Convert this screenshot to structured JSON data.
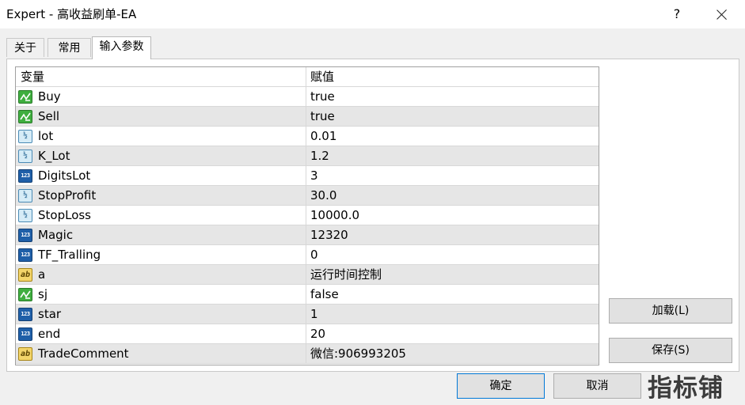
{
  "window": {
    "title": "Expert - 高收益刷单-EA",
    "help_label": "?",
    "close_icon": "close-icon"
  },
  "tabs": [
    {
      "label": "关于",
      "active": false
    },
    {
      "label": "常用",
      "active": false
    },
    {
      "label": "输入参数",
      "active": true
    }
  ],
  "grid": {
    "headers": {
      "variable": "变量",
      "value": "赋值"
    },
    "rows": [
      {
        "name": "Buy",
        "value": "true",
        "type": "bool"
      },
      {
        "name": "Sell",
        "value": "true",
        "type": "bool"
      },
      {
        "name": "lot",
        "value": "0.01",
        "type": "double"
      },
      {
        "name": "K_Lot",
        "value": "1.2",
        "type": "double"
      },
      {
        "name": "DigitsLot",
        "value": "3",
        "type": "int"
      },
      {
        "name": "StopProfit",
        "value": "30.0",
        "type": "double"
      },
      {
        "name": "StopLoss",
        "value": "10000.0",
        "type": "double"
      },
      {
        "name": "Magic",
        "value": "12320",
        "type": "int"
      },
      {
        "name": "TF_Tralling",
        "value": "0",
        "type": "int"
      },
      {
        "name": "a",
        "value": "运行时间控制",
        "type": "string"
      },
      {
        "name": "sj",
        "value": "false",
        "type": "bool"
      },
      {
        "name": "star",
        "value": "1",
        "type": "int"
      },
      {
        "name": "end",
        "value": "20",
        "type": "int"
      },
      {
        "name": "TradeComment",
        "value": "微信:906993205",
        "type": "string"
      }
    ]
  },
  "icons": {
    "double_glyph": "½",
    "int_glyph": "123",
    "string_glyph": "ab"
  },
  "buttons": {
    "load": "加载(L)",
    "save": "保存(S)",
    "ok": "确定",
    "cancel": "取消"
  },
  "watermark": "指标铺"
}
